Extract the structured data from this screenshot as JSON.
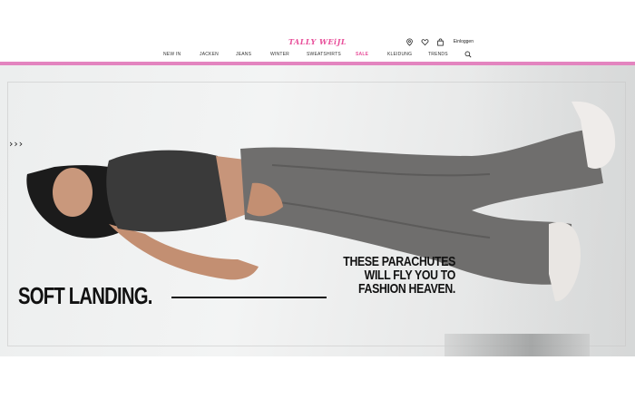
{
  "header": {
    "logo": "TALLY WEiJL",
    "login_label": "Einloggen",
    "icons": [
      "location-pin-icon",
      "heart-icon",
      "shopping-bag-icon",
      "search-icon"
    ],
    "brand_color": "#e84f9a",
    "accent_bar_color": "#e384bf"
  },
  "nav": {
    "items": [
      "NEW IN",
      "JACKEN",
      "JEANS",
      "WINTER",
      "SWEATSHIRTS",
      "SALE",
      "KLEIDUNG",
      "TRENDS"
    ]
  },
  "hero": {
    "headline": "SOFT LANDING.",
    "tagline_lines": [
      "THESE PARACHUTES",
      "WILL FLY YOU TO",
      "FASHION HEAVEN."
    ],
    "arrows_left": "›››",
    "arrows_right": "‹‹‹"
  }
}
